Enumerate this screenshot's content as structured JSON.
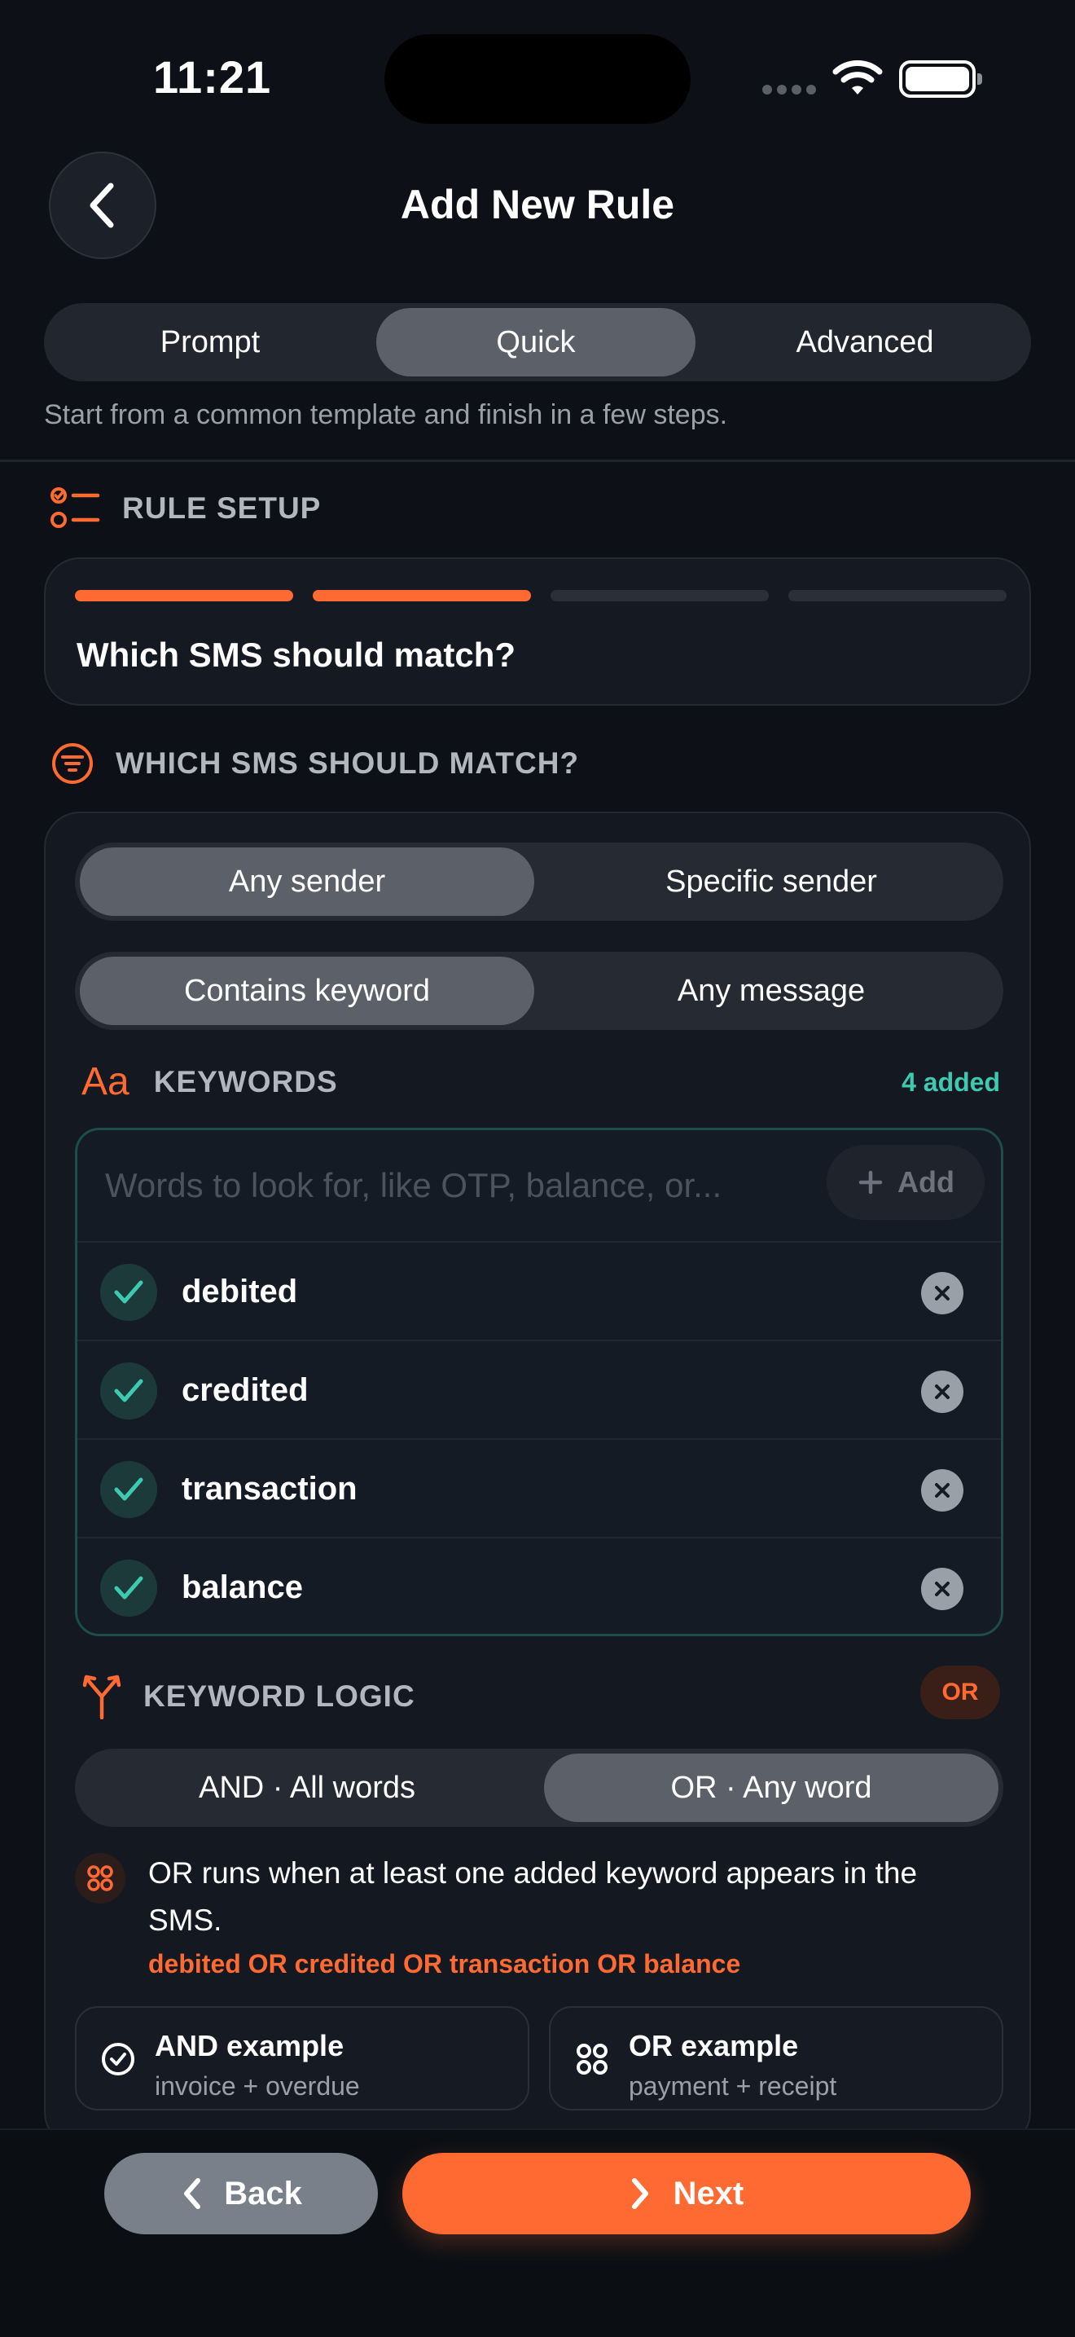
{
  "status": {
    "time": "11:21"
  },
  "header": {
    "title": "Add New Rule"
  },
  "modes": {
    "tabs": [
      "Prompt",
      "Quick",
      "Advanced"
    ],
    "selected": "Quick"
  },
  "subtitle": "Start from a common template and finish in a few steps.",
  "setup": {
    "heading": "RULE SETUP",
    "steps_total": 4,
    "steps_done": 2,
    "question": "Which SMS should match?"
  },
  "match": {
    "heading": "WHICH SMS SHOULD MATCH?",
    "sender_options": [
      "Any sender",
      "Specific sender"
    ],
    "sender_selected": "Any sender",
    "content_options": [
      "Contains keyword",
      "Any message"
    ],
    "content_selected": "Contains keyword"
  },
  "keywords": {
    "icon_text": "Aa",
    "heading": "KEYWORDS",
    "count": "4 added",
    "placeholder": "Words to look for, like OTP, balance, or...",
    "add_label": "Add",
    "items": [
      "debited",
      "credited",
      "transaction",
      "balance"
    ]
  },
  "logic": {
    "heading": "KEYWORD LOGIC",
    "badge": "OR",
    "options": [
      "AND · All words",
      "OR · Any word"
    ],
    "selected": "OR · Any word",
    "info": "OR runs when at least one added keyword appears in the SMS.",
    "expression": "debited OR credited OR transaction OR balance",
    "examples": [
      {
        "title": "AND example",
        "sub": "invoice + overdue"
      },
      {
        "title": "OR example",
        "sub": "payment + receipt"
      }
    ]
  },
  "footer": {
    "back_label": "Back",
    "next_label": "Next"
  },
  "colors": {
    "accent": "#ff6a33",
    "teal": "#3ec9b1",
    "background": "#0d1117"
  }
}
